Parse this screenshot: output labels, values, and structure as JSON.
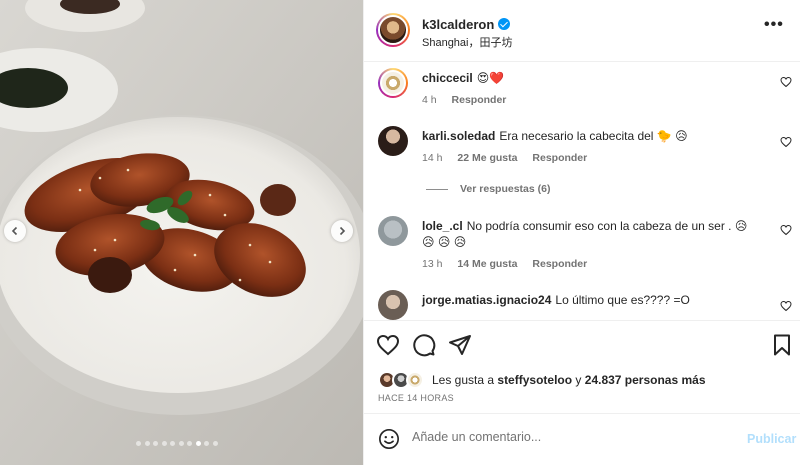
{
  "post": {
    "username": "k3lcalderon",
    "location": "Shanghai，田子坊",
    "more_icon": "more-horizontal-icon"
  },
  "carousel": {
    "count": 10,
    "active_index": 7
  },
  "comments": [
    {
      "user": "chiccecil",
      "text": "😍❤️",
      "time": "4 h",
      "likes": "",
      "reply": "Responder"
    },
    {
      "user": "karli.soledad",
      "text": "Era necesario la cabecita del 🐤 😥",
      "time": "14 h",
      "likes": "22 Me gusta",
      "reply": "Responder",
      "replies": "Ver respuestas (6)"
    },
    {
      "user": "lole_.cl",
      "text": "No podría consumir eso con la cabeza de un ser . 😥 😥 😥 😥",
      "time": "13 h",
      "likes": "14 Me gusta",
      "reply": "Responder"
    },
    {
      "user": "jorge.matias.ignacio24",
      "text": "Lo último que es???? =O"
    }
  ],
  "likes": {
    "prefix": "Les gusta a",
    "user": "steffysoteloo",
    "joiner": "y",
    "count": "24.837 personas más"
  },
  "timestamp": "HACE 14 HORAS",
  "composer": {
    "placeholder": "Añade un comentario...",
    "post_label": "Publicar"
  },
  "colors": {
    "accent": "#0095f6",
    "post_disabled": "#b2dffc",
    "like_red": "#ed4956"
  }
}
